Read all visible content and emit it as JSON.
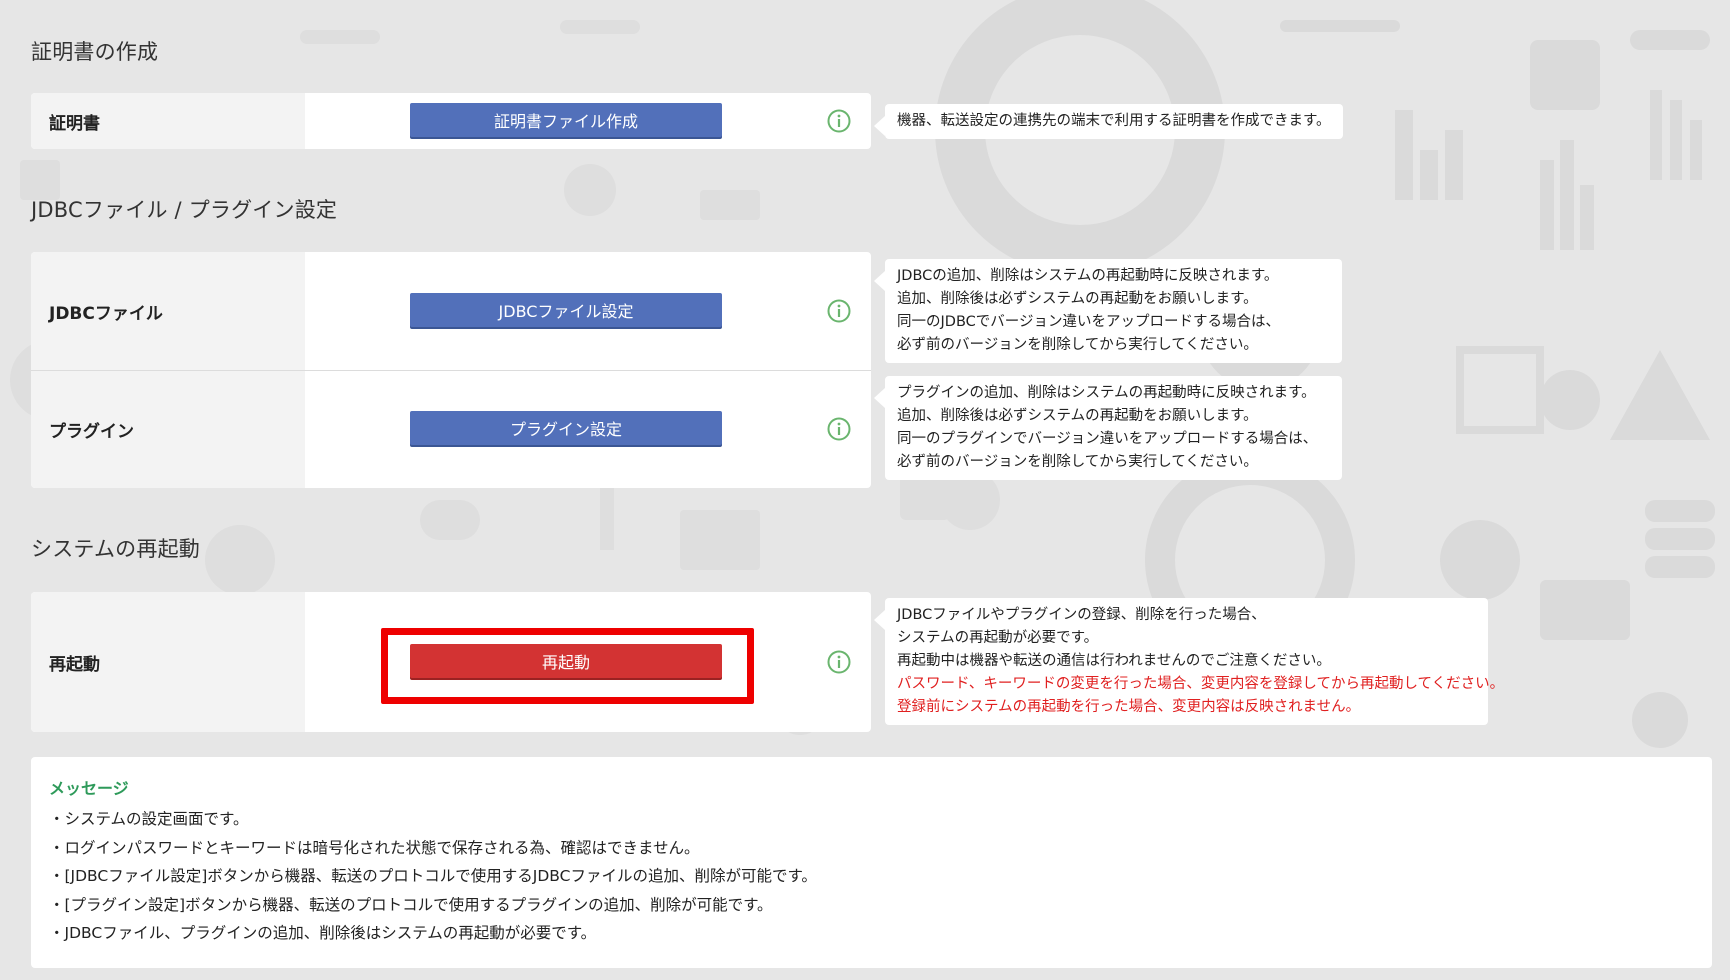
{
  "sections": {
    "certificate": {
      "title": "証明書の作成",
      "row": {
        "label": "証明書",
        "button_label": "証明書ファイル作成",
        "info_lines": [
          "機器、転送設定の連携先の端末で利用する証明書を作成できます。"
        ]
      }
    },
    "jdbc_plugin": {
      "title": "JDBCファイル / プラグイン設定",
      "rows": [
        {
          "label": "JDBCファイル",
          "button_label": "JDBCファイル設定",
          "info_lines": [
            "JDBCの追加、削除はシステムの再起動時に反映されます。",
            "追加、削除後は必ずシステムの再起動をお願いします。",
            "同一のJDBCでバージョン違いをアップロードする場合は、",
            "必ず前のバージョンを削除してから実行してください。"
          ]
        },
        {
          "label": "プラグイン",
          "button_label": "プラグイン設定",
          "info_lines": [
            "プラグインの追加、削除はシステムの再起動時に反映されます。",
            "追加、削除後は必ずシステムの再起動をお願いします。",
            "同一のプラグインでバージョン違いをアップロードする場合は、",
            "必ず前のバージョンを削除してから実行してください。"
          ]
        }
      ]
    },
    "restart": {
      "title": "システムの再起動",
      "row": {
        "label": "再起動",
        "button_label": "再起動",
        "info_lines": [
          "JDBCファイルやプラグインの登録、削除を行った場合、",
          "システムの再起動が必要です。",
          "再起動中は機器や転送の通信は行われませんのでご注意ください。"
        ],
        "warning_lines": [
          "パスワード、キーワードの変更を行った場合、変更内容を登録してから再起動してください。",
          "登録前にシステムの再起動を行った場合、変更内容は反映されません。"
        ]
      }
    }
  },
  "message": {
    "title": "メッセージ",
    "items": [
      "・システムの設定画面です。",
      "・ログインパスワードとキーワードは暗号化された状態で保存される為、確認はできません。",
      "・[JDBCファイル設定]ボタンから機器、転送のプロトコルで使用するJDBCファイルの追加、削除が可能です。",
      "・[プラグイン設定]ボタンから機器、転送のプロトコルで使用するプラグインの追加、削除が可能です。",
      "・JDBCファイル、プラグインの追加、削除後はシステムの再起動が必要です。"
    ]
  },
  "colors": {
    "primary_button": "#5270ba",
    "danger_button": "#d33333",
    "info_icon": "#6ab56e",
    "highlight_border": "#ee0000",
    "warning_text": "#e02020",
    "message_title": "#2e9a5a"
  }
}
